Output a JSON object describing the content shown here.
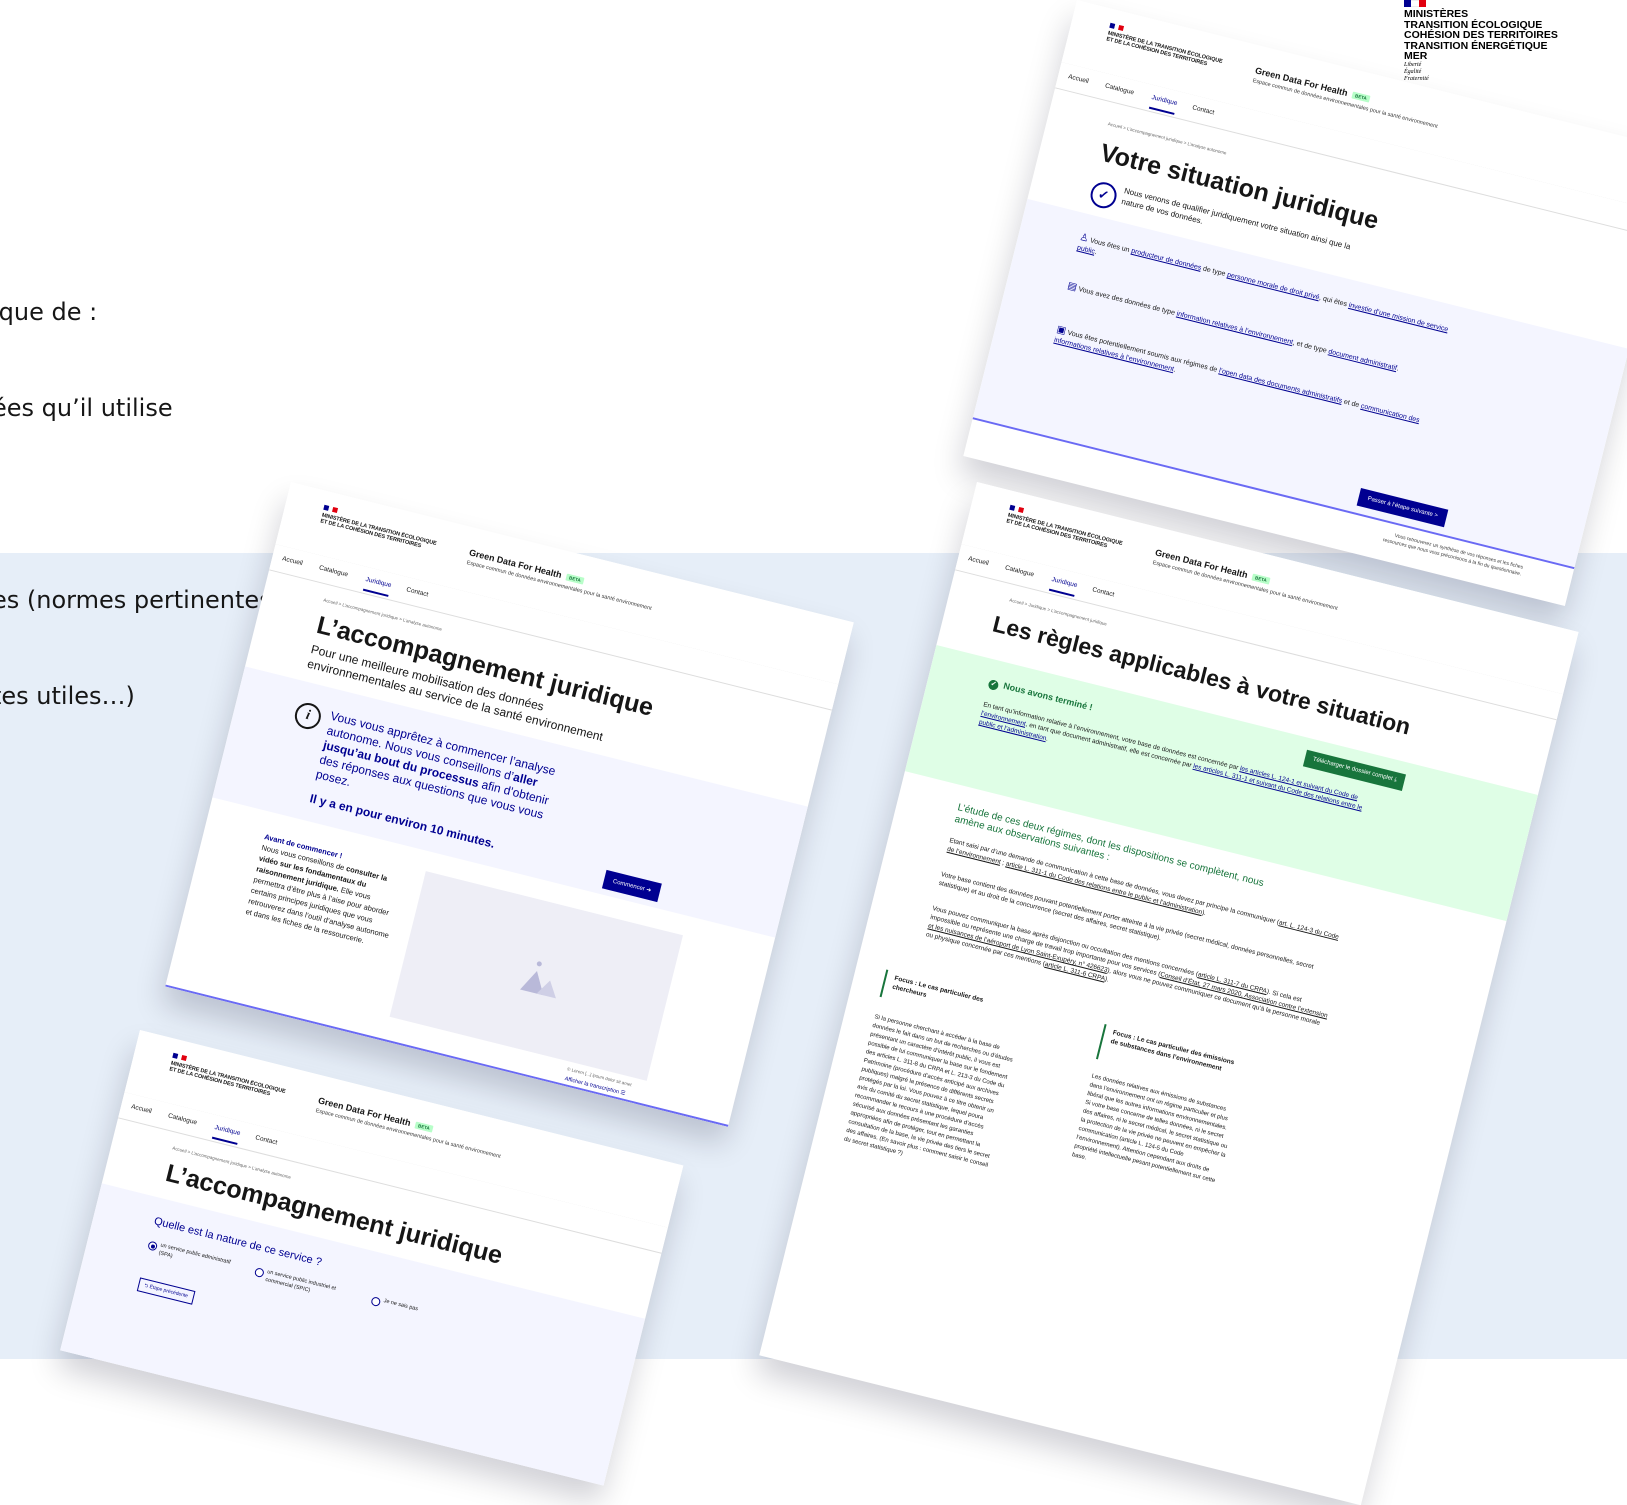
{
  "colors": {
    "bleu_france": "#000091",
    "rouge_marianne": "#e1000f",
    "green": "#18753c",
    "band": "#e6eef8"
  },
  "intro": {
    "lines": [
      "ique de :",
      "ées qu’il utilise",
      "",
      "es (normes pertinentes,",
      "tes utiles…)"
    ]
  },
  "ministry_logo": {
    "lines": [
      "MINISTÈRES",
      "TRANSITION ÉCOLOGIQUE",
      "COHÉSION DES TERRITOIRES",
      "TRANSITION ÉNERGÉTIQUE",
      "MER"
    ],
    "motto": [
      "Liberté",
      "Égalité",
      "Fraternité"
    ]
  },
  "header": {
    "ministry": "MINISTÈRE DE LA TRANSITION ÉCOLOGIQUE ET DE LA COHÉSION DES TERRITOIRES",
    "motto": [
      "Liberté",
      "Égalité",
      "Fraternité"
    ],
    "title": "Green Data For Health",
    "badge": "BETA",
    "tagline": "Espace commun de données environnementales pour la santé environnement"
  },
  "nav": {
    "accueil": "Accueil",
    "catalogue": "Catalogue",
    "juridique": "Juridique",
    "contact": "Contact"
  },
  "screen_situation": {
    "breadcrumb": "Accueil  >  L’accompagnement juridique  >  L’analyse autonome",
    "title": "Votre situation juridique",
    "lead": "Nous venons de qualifier juridiquement votre situation ainsi que la nature de vos données.",
    "item1_a": "Vous êtes un ",
    "item1_l1": "producteur de données",
    "item1_b": " de type ",
    "item1_l2": "personne morale de droit privé",
    "item1_c": ", qui êtes ",
    "item1_l3": "investie d’une mission de service public",
    "item1_d": ".",
    "item2_a": "Vous avez des données de type ",
    "item2_l1": "information relatives à l’environnement",
    "item2_b": ", et de type ",
    "item2_l2": "document administratif",
    "item2_c": ".",
    "item3_a": "Vous êtes potentiellement soumis aux régimes de ",
    "item3_l1": "l’open data des documents administratifs",
    "item3_b": " et de ",
    "item3_l2": "communication des informations relatives à l’environnement",
    "item3_c": ".",
    "footer_note": "Vous retrouverez un synthèse de vos réponses et les fiches ressources que nous vous préconisons à la fin du questionnaire.",
    "next_button": "Passer à l’étape suivante  >"
  },
  "screen_intro": {
    "breadcrumb": "Accueil  >  L’accompagnement juridique  >  L’analyse autonome",
    "title": "L’accompagnement juridique",
    "lead": "Pour une meilleure mobilisation des données environnementales au service de la santé environnement",
    "info_icon": "i",
    "callout_a": "Vous vous apprêtez à commencer l’analyse autonome. Nous vous conseillons d’",
    "callout_b": "aller jusqu’au bout du processus",
    "callout_c": " afin d’obtenir des réponses aux questions que vous vous posez.",
    "callout_time": "Il y a en pour environ 10 minutes.",
    "before_title": "Avant de commencer !",
    "before_a": "Nous vous conseillons de ",
    "before_b": "consulter la vidéo sur les fondamentaux du raisonnement juridique.",
    "before_c": " Elle vous permettra d’être plus à l’aise pour aborder certains principes juridiques que vous retrouverez dans l’outil d’analyse autonome et dans les fiches de la ressourcerie.",
    "start_button": "Commencer  ➜",
    "caption": "© Lorem [...] ipsum dolor sit amet",
    "transcript": "Afficher la transcription  ☰"
  },
  "screen_question": {
    "breadcrumb": "Accueil  >  L’accompagnement juridique  >  L’analyse autonome",
    "title": "L’accompagnement juridique",
    "question": "Quelle est la nature de ce service ?",
    "opt1": "un service public administratif (SPA)",
    "opt2": "un service public industriel et commercial (SPIC)",
    "opt3": "Je ne sais pas",
    "back_button": "⮌ Étape précédente"
  },
  "screen_rules": {
    "breadcrumb": "Accueil  >  Juridique  >  L’accompagnement juridique",
    "title": "Les règles applicables à votre situation",
    "done": "Nous avons terminé !",
    "download_button": "Télécharger le dossier complet  ⤓",
    "done_a": "En tant qu’information relative à l’environnement, votre base de données est concernée par ",
    "done_l1": "les articles L. 124-1 et suivant du Code de l’environnement",
    "done_b": ", en tant que document administratif, elle est concernée par ",
    "done_l2": "les articles L. 311-1 et suivant du Code des relations entre le public et l’administration",
    "done_c": ".",
    "study_title": "L’étude de ces deux régimes, dont les dispositions se complètent, nous amène aux observations suivantes :",
    "p1_a": "Etant saisi par d’une demande de communication à cette base de données, vous devez par principe la communiquer (",
    "p1_l1": "art. L. 124-3 du Code de l’environnement",
    "p1_b": " ; ",
    "p1_l2": "article L. 311-1 du Code des relations entre le public et l’administration",
    "p1_c": ").",
    "p2": "Votre base contient des données pouvant potentiellement porter atteinte à la vie privée (secret médical, données personnelles, secret statistique) et au droit de la concurrence (secret des affaires, secret statistique).",
    "p3_a": "Vous pouvez communiquer la base après disjonction ou occultation des mentions concernées (",
    "p3_l1": "article L. 311-7 du CRPA",
    "p3_b": "). Si cela est impossible ou représente une charge de travail trop importante pour vos services (",
    "p3_l2": "Conseil d’État, 27 mars 2020, Association contre l’extension et les nuisances de l’aéroport de Lyon Saint-Exupéry, n° 426623",
    "p3_c": "), alors vous ne pouvez communiquer ce document qu’à la personne morale ou physique concernée par ces mentions (",
    "p3_l3": "article L. 311-6 CRPA",
    "p3_d": ").",
    "focus1_title": "Focus : Le cas particulier des chercheurs",
    "focus1_text": "Si la personne cherchant à accéder à la base de données le fait dans un but de recherches ou d’études présentant un caractère d’intérêt public, il vous est possible de lui communiquer la base sur le fondement des articles L. 311-8 du CRPA et L. 213-3 du Code du Patrimoine (procédure d’accès anticipé aux archives publiques) malgré la présence de différents secrets protégés par la loi. Vous pouvez à ce titre obtenir un avis du comité du secret statistique, lequel poura recommander le recours à une procédure d’accès sécurisé aux données présentant les garanties appropriées afin de protéger, tout en permettant la consultation de la base, la vie privée des tiers le secret des affaires. (En savoir plus : comment saisir le conseil du secret statistique ?)",
    "focus2_title": "Focus : Le cas particulier des émissions de substances dans l’environnement",
    "focus2_text": "Les données relatives aux émissions de substances dans l’environnement ont un régime particulier et plus libéral que les autres informations environnementales. Si votre base concerne de telles données, ni le secret des affaires, ni le secret médical, le secret statistique ou la protection de la vie privée ne peuvent en empêcher la communication (article L. 124-5 du Code l’environnement). Attention cependant aux droits de propriété intellectuelle pesant potentiellement sur cette base."
  }
}
